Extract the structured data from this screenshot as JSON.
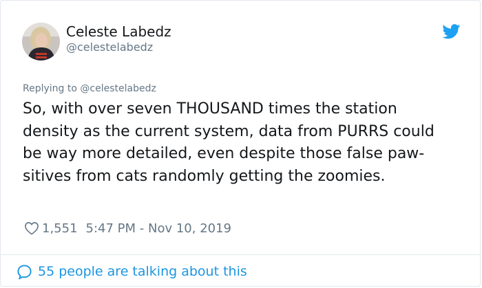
{
  "author": {
    "display_name": "Celeste Labedz",
    "handle": "@celestelabedz"
  },
  "reply": {
    "prefix": "Replying to ",
    "mention": "@celestelabedz"
  },
  "tweet": {
    "text": "So, with over seven THOUSAND times the station density as the current system, data from PURRS could be way more detailed, even despite those false paw-sitives from cats randomly getting the zoomies."
  },
  "meta": {
    "likes": "1,551",
    "timestamp": "5:47 PM - Nov 10, 2019"
  },
  "footer": {
    "talking_text": "55 people are talking about this"
  },
  "icons": {
    "brand": "twitter-bird-icon",
    "like": "heart-icon",
    "conversation": "speech-bubble-icon"
  },
  "colors": {
    "brand_blue": "#1da1f2",
    "link_blue": "#1b95e0",
    "text": "#14171a",
    "muted": "#657786",
    "border": "#e1e8ed"
  }
}
